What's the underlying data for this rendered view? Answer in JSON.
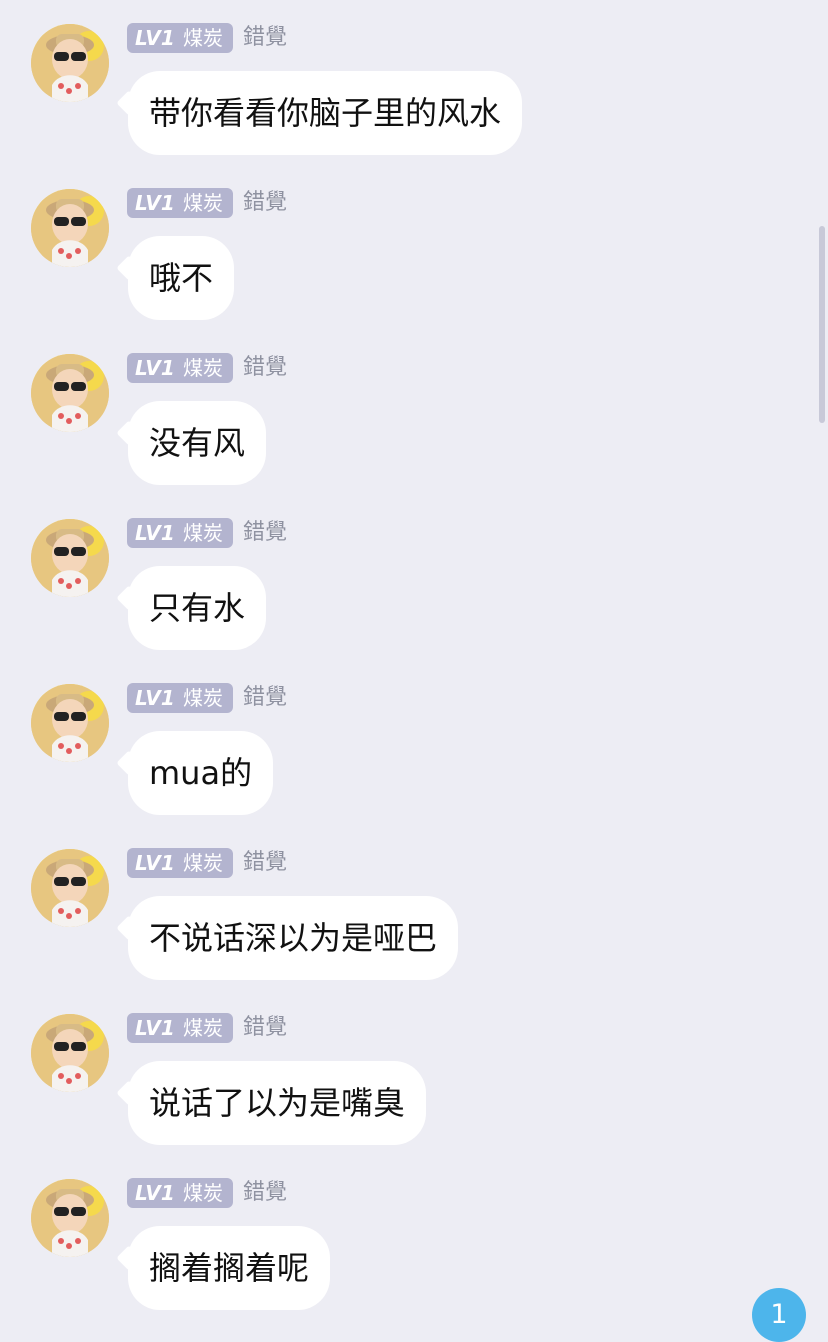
{
  "messages": [
    {
      "level": "LV1",
      "rank": "煤炭",
      "username": "錯覺",
      "text": "带你看看你脑子里的风水"
    },
    {
      "level": "LV1",
      "rank": "煤炭",
      "username": "錯覺",
      "text": "哦不"
    },
    {
      "level": "LV1",
      "rank": "煤炭",
      "username": "錯覺",
      "text": "没有风"
    },
    {
      "level": "LV1",
      "rank": "煤炭",
      "username": "錯覺",
      "text": "只有水"
    },
    {
      "level": "LV1",
      "rank": "煤炭",
      "username": "錯覺",
      "text": "mua的"
    },
    {
      "level": "LV1",
      "rank": "煤炭",
      "username": "錯覺",
      "text": "不说话深以为是哑巴"
    },
    {
      "level": "LV1",
      "rank": "煤炭",
      "username": "錯覺",
      "text": "说话了以为是嘴臭"
    },
    {
      "level": "LV1",
      "rank": "煤炭",
      "username": "錯覺",
      "text": "搁着搁着呢"
    }
  ],
  "unread_count": "1",
  "colors": {
    "background": "#ededf4",
    "bubble": "#ffffff",
    "badge": "#b3b4cf",
    "username": "#8f92a1",
    "unread": "#4db5eb"
  },
  "icons": {
    "avatar": "avatar-photo"
  }
}
